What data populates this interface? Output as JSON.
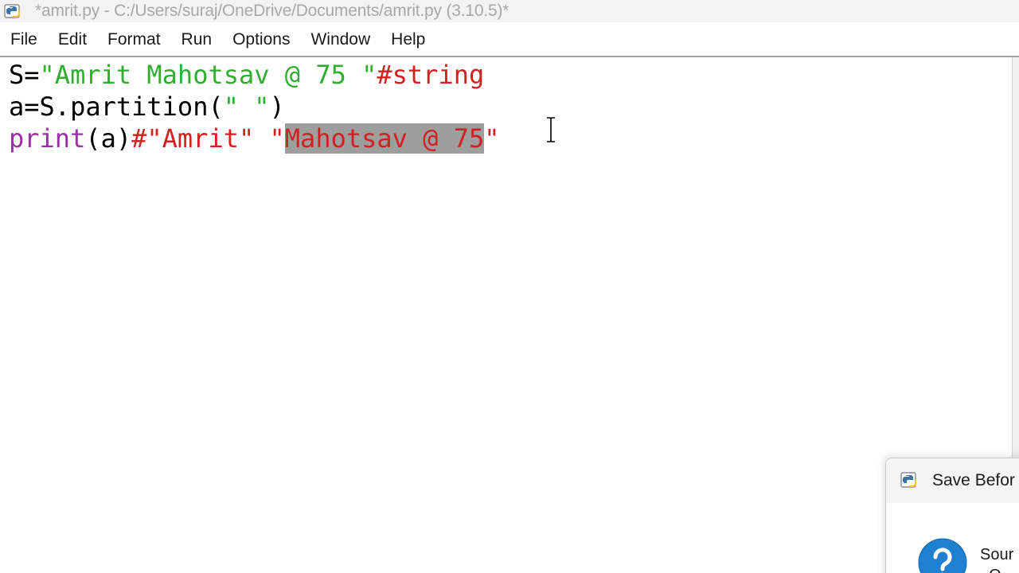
{
  "window": {
    "title": "*amrit.py - C:/Users/suraj/OneDrive/Documents/amrit.py (3.10.5)*"
  },
  "menu": {
    "items": [
      "File",
      "Edit",
      "Format",
      "Run",
      "Options",
      "Window",
      "Help"
    ]
  },
  "editor": {
    "line1": {
      "var": "S=",
      "str": "\"Amrit Mahotsav @ 75 \"",
      "comment": "#string"
    },
    "line2": {
      "code": "a=S.partition(",
      "str": "\" \"",
      "close": ")"
    },
    "line3": {
      "builtin": "print",
      "args": "(a)",
      "comment": "#\"Amrit\" \"",
      "selected": "Mahotsav @ 75",
      "after": "\""
    }
  },
  "dialog": {
    "title": "Save Befor",
    "message_line1": "Sour",
    "message_line2": "  O",
    "icon": "question-icon"
  },
  "colors": {
    "string": "#2fae2f",
    "comment": "#d32020",
    "builtin": "#9b2fa6",
    "selection": "#9e9e9e"
  }
}
